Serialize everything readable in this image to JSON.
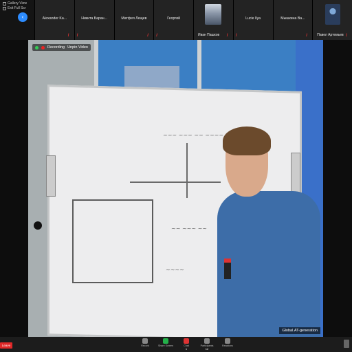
{
  "view": {
    "gallery": "Gallery View",
    "exit_full": "Exit Full Scr"
  },
  "participants": [
    {
      "name": "Alexander Ka..."
    },
    {
      "name": "Никита Баран..."
    },
    {
      "name": "Матфея Лещев"
    },
    {
      "name": "Георгий"
    },
    {
      "name": "Иван Пашков",
      "tile_label": true
    },
    {
      "name": "Lucie Ilya"
    },
    {
      "name": "Мышкина Ва..."
    },
    {
      "name": "Павел Артемьев",
      "tile_label": true
    }
  ],
  "video": {
    "recording": "Recording",
    "unpin": "Unpin Video",
    "speaker_tag": "Global.AT-generation"
  },
  "toolbar": {
    "leave": "Leave",
    "items": [
      {
        "label": "Record",
        "icon": "record-icon",
        "badge": ""
      },
      {
        "label": "Share Screen",
        "icon": "share-screen-icon",
        "badge": ""
      },
      {
        "label": "Chat",
        "icon": "chat-icon",
        "badge": "1"
      },
      {
        "label": "Participants",
        "icon": "participants-icon",
        "badge": "12"
      },
      {
        "label": "Reactions",
        "icon": "reactions-icon",
        "badge": ""
      }
    ]
  },
  "colors": {
    "leave": "#e02828",
    "accent": "#2d8cff",
    "share": "#24b04a"
  }
}
